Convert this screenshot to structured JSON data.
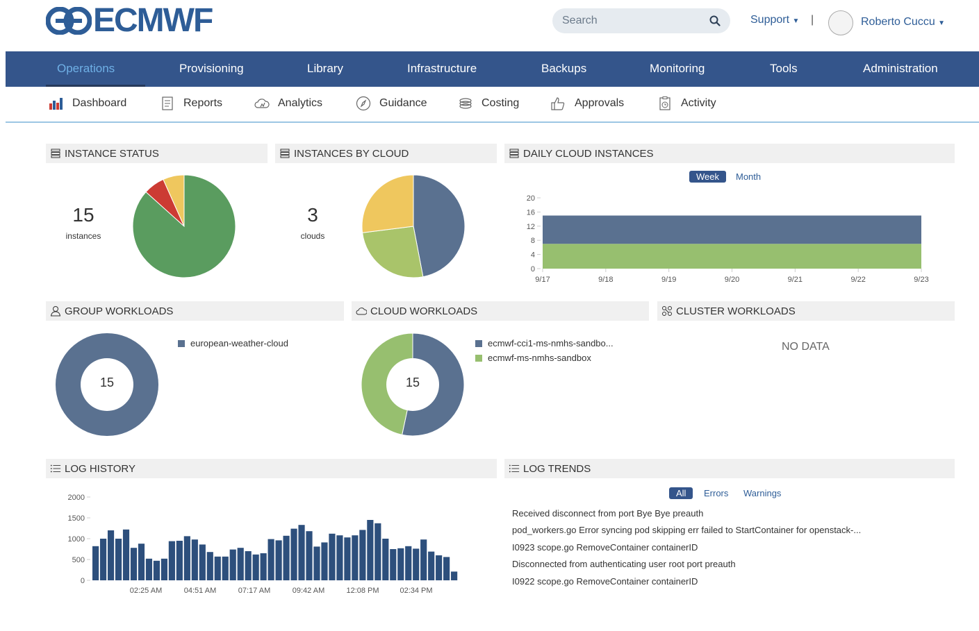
{
  "header": {
    "logo_text": "ECMWF",
    "search_placeholder": "Search",
    "support_label": "Support",
    "separator": "|",
    "user_name": "Roberto Cuccu"
  },
  "main_nav": [
    {
      "label": "Operations",
      "active": true
    },
    {
      "label": "Provisioning"
    },
    {
      "label": "Library"
    },
    {
      "label": "Infrastructure"
    },
    {
      "label": "Backups"
    },
    {
      "label": "Monitoring"
    },
    {
      "label": "Tools"
    },
    {
      "label": "Administration"
    }
  ],
  "sub_nav": [
    {
      "label": "Dashboard",
      "icon": "dashboard-icon"
    },
    {
      "label": "Reports",
      "icon": "reports-icon"
    },
    {
      "label": "Analytics",
      "icon": "analytics-icon"
    },
    {
      "label": "Guidance",
      "icon": "guidance-icon"
    },
    {
      "label": "Costing",
      "icon": "costing-icon"
    },
    {
      "label": "Approvals",
      "icon": "approvals-icon"
    },
    {
      "label": "Activity",
      "icon": "activity-icon"
    }
  ],
  "colors": {
    "brand": "#2e5d97",
    "nav_bg": "#34558b",
    "slate": "#5a7190",
    "green": "#5a9c5f",
    "light_green": "#97bf6f",
    "red": "#cc3b33",
    "yellow": "#efc75e"
  },
  "instance_status": {
    "title": "INSTANCE STATUS",
    "count": "15",
    "count_label": "instances",
    "chart_data": {
      "type": "pie",
      "values": [
        13,
        1,
        1
      ],
      "colors": [
        "#5a9c5f",
        "#cc3b33",
        "#efc75e"
      ]
    }
  },
  "instances_by_cloud": {
    "title": "INSTANCES BY CLOUD",
    "count": "3",
    "count_label": "clouds",
    "chart_data": {
      "type": "pie",
      "values": [
        47,
        26,
        27
      ],
      "colors": [
        "#5a7190",
        "#a9c46a",
        "#efc75e"
      ]
    }
  },
  "daily_cloud_instances": {
    "title": "DAILY CLOUD INSTANCES",
    "toggles": [
      {
        "label": "Week",
        "active": true
      },
      {
        "label": "Month"
      }
    ],
    "chart_data": {
      "type": "area",
      "x": [
        "9/17",
        "9/18",
        "9/19",
        "9/20",
        "9/21",
        "9/22",
        "9/23"
      ],
      "series": [
        {
          "values": [
            7,
            7,
            7,
            7,
            7,
            7,
            7
          ],
          "color": "#97bf6f"
        },
        {
          "values": [
            8,
            8,
            8,
            8,
            8,
            8,
            8
          ],
          "color": "#5a7190"
        }
      ],
      "stacked": true,
      "ylim": [
        0,
        20
      ],
      "yticks": [
        "0",
        "4",
        "8",
        "12",
        "16",
        "20"
      ]
    }
  },
  "group_workloads": {
    "title": "GROUP WORKLOADS",
    "center": "15",
    "legend": [
      {
        "label": "european-weather-cloud",
        "color": "#5a7190"
      }
    ],
    "chart_data": {
      "type": "pie",
      "values": [
        15
      ],
      "colors": [
        "#5a7190"
      ]
    }
  },
  "cloud_workloads": {
    "title": "CLOUD WORKLOADS",
    "center": "15",
    "legend": [
      {
        "label": "ecmwf-cci1-ms-nmhs-sandbo...",
        "color": "#5a7190"
      },
      {
        "label": "ecmwf-ms-nmhs-sandbox",
        "color": "#97bf6f"
      }
    ],
    "chart_data": {
      "type": "pie",
      "values": [
        8,
        7
      ],
      "colors": [
        "#5a7190",
        "#97bf6f"
      ]
    }
  },
  "cluster_workloads": {
    "title": "CLUSTER WORKLOADS",
    "empty_text": "NO DATA"
  },
  "log_history": {
    "title": "LOG HISTORY",
    "chart_data": {
      "type": "bar",
      "yticks": [
        "0",
        "500",
        "1000",
        "1500",
        "2000"
      ],
      "ylim": [
        0,
        2000
      ],
      "x_ticks": [
        "02:25 AM",
        "04:51 AM",
        "07:17 AM",
        "09:42 AM",
        "12:08 PM",
        "02:34 PM"
      ],
      "values": [
        820,
        1000,
        1200,
        1000,
        1220,
        780,
        880,
        520,
        470,
        520,
        940,
        950,
        1060,
        980,
        860,
        680,
        570,
        570,
        740,
        780,
        700,
        620,
        650,
        990,
        960,
        1070,
        1240,
        1330,
        1180,
        810,
        910,
        1120,
        1080,
        1030,
        1080,
        1210,
        1450,
        1370,
        1000,
        750,
        770,
        820,
        760,
        980,
        690,
        600,
        560,
        210
      ],
      "color": "#2d4f7c"
    }
  },
  "log_trends": {
    "title": "LOG TRENDS",
    "toggles": [
      {
        "label": "All",
        "active": true
      },
      {
        "label": "Errors"
      },
      {
        "label": "Warnings"
      }
    ],
    "lines": [
      "Received disconnect from port Bye Bye preauth",
      "pod_workers.go Error syncing pod skipping err failed to StartContainer for openstack-...",
      "I0923 scope.go RemoveContainer containerID",
      "Disconnected from authenticating user root port preauth",
      "I0922 scope.go RemoveContainer containerID"
    ]
  }
}
